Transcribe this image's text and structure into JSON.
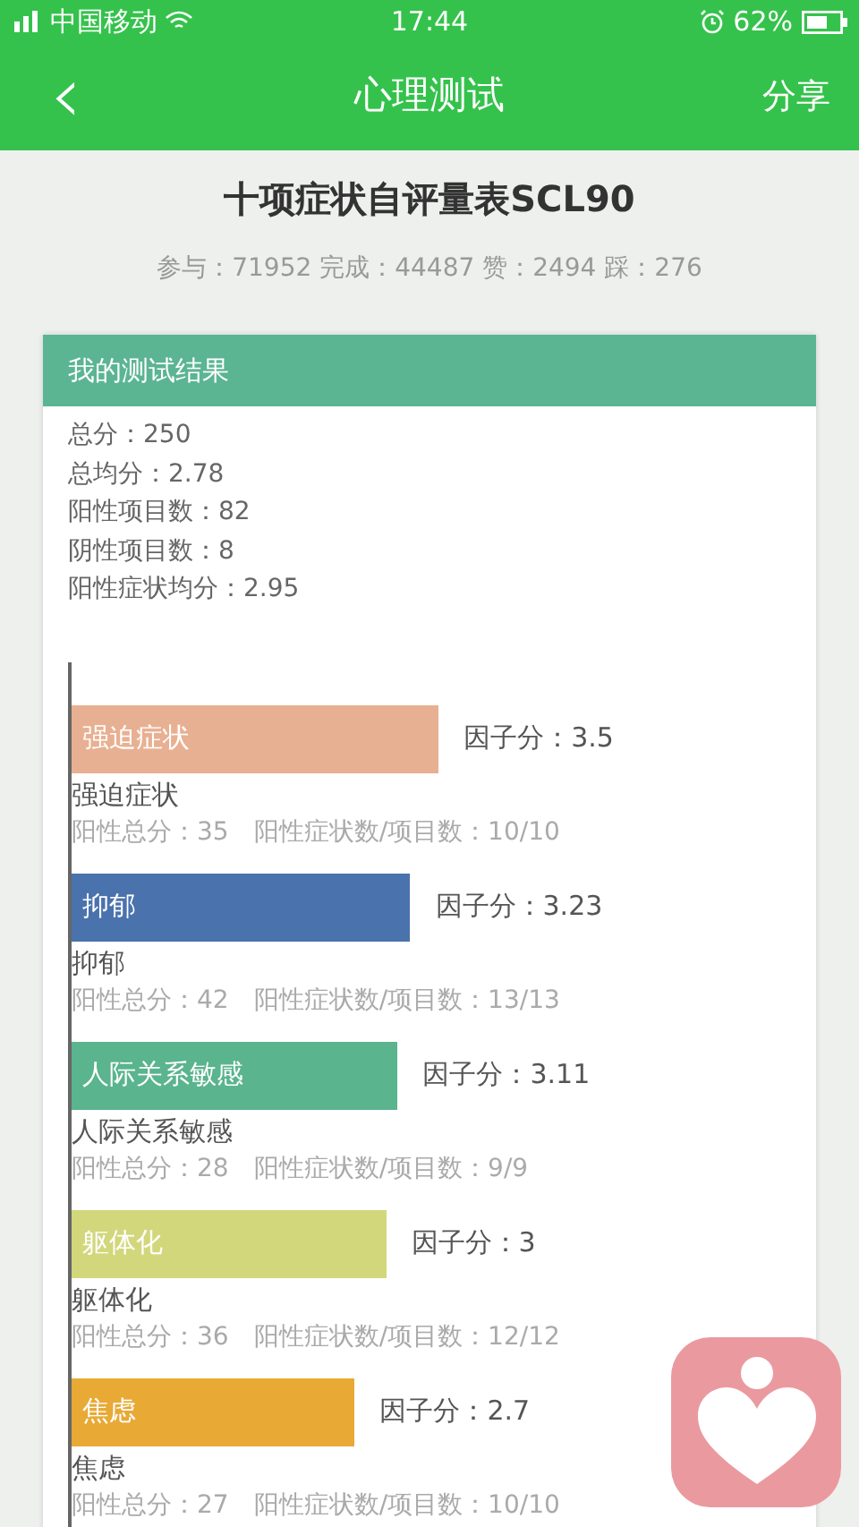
{
  "status_bar": {
    "carrier": "中国移动",
    "time": "17:44",
    "battery": "62%"
  },
  "nav": {
    "back": "‹",
    "title": "心理测试",
    "share": "分享"
  },
  "test": {
    "title": "十项症状自评量表SCL90",
    "stats": "参与：71952 完成：44487 赞：2494 踩：276"
  },
  "result": {
    "header": "我的测试结果",
    "summary": [
      "总分：250",
      "总均分：2.78",
      "阳性项目数：82",
      "阴性项目数：8",
      "阳性症状均分：2.95"
    ],
    "factors": [
      {
        "bar_label": "强迫症状",
        "score": "因子分：3.5",
        "color": "#e8b092",
        "name": "强迫症状",
        "detail": "阳性总分：35　阳性症状数/项目数：10/10"
      },
      {
        "bar_label": "抑郁",
        "score": "因子分：3.23",
        "color": "#4a72ad",
        "name": "抑郁",
        "detail": "阳性总分：42　阳性症状数/项目数：13/13"
      },
      {
        "bar_label": "人际关系敏感",
        "score": "因子分：3.11",
        "color": "#5ab48e",
        "name": "人际关系敏感",
        "detail": "阳性总分：28　阳性症状数/项目数：9/9"
      },
      {
        "bar_label": "躯体化",
        "score": "因子分：3",
        "color": "#d2d77c",
        "name": "躯体化",
        "detail": "阳性总分：36　阳性症状数/项目数：12/12"
      },
      {
        "bar_label": "焦虑",
        "score": "因子分：2.7",
        "color": "#e8a935",
        "name": "焦虑",
        "detail": "阳性总分：27　阳性症状数/项目数：10/10"
      }
    ]
  }
}
